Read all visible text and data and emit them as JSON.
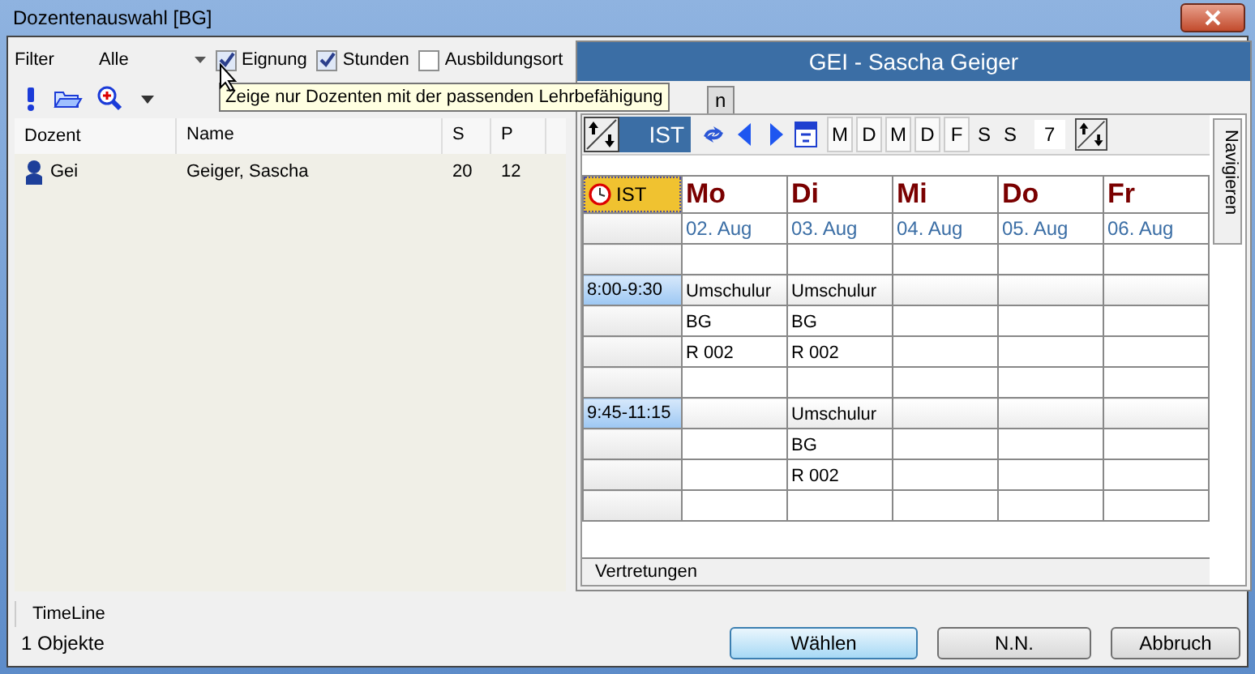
{
  "window": {
    "title": "Dozentenauswahl [BG]"
  },
  "filter": {
    "label": "Filter",
    "value": "Alle",
    "checkboxes": [
      {
        "label": "Eignung",
        "checked": true
      },
      {
        "label": "Stunden",
        "checked": true
      },
      {
        "label": "Ausbildungsort",
        "checked": false
      }
    ]
  },
  "tooltip": "Zeige nur Dozenten mit der passenden Lehrbefähigung",
  "table": {
    "columns": [
      "Dozent",
      "Name",
      "S",
      "P"
    ],
    "rows": [
      {
        "cells": [
          "Gei",
          "Geiger, Sascha",
          "20",
          "12"
        ],
        "selected": false
      }
    ]
  },
  "detail": {
    "title": "GEI - Sascha Geiger",
    "tabs": [
      {
        "label": "n"
      }
    ],
    "mode": "IST",
    "weekdays": [
      {
        "label": "M",
        "on": true
      },
      {
        "label": "D",
        "on": true
      },
      {
        "label": "M",
        "on": true
      },
      {
        "label": "D",
        "on": true
      },
      {
        "label": "F",
        "on": true
      },
      {
        "label": "S",
        "on": false
      },
      {
        "label": "S",
        "on": false
      }
    ],
    "day_count": "7",
    "corner": "IST",
    "days": [
      {
        "name": "Mo",
        "date": "02. Aug"
      },
      {
        "name": "Di",
        "date": "03. Aug"
      },
      {
        "name": "Mi",
        "date": "04. Aug"
      },
      {
        "name": "Do",
        "date": "05. Aug"
      },
      {
        "name": "Fr",
        "date": "06. Aug"
      }
    ],
    "slots": [
      {
        "time": "8:00-9:30",
        "cells": [
          [
            "Umschulur",
            "BG",
            "R 002"
          ],
          [
            "Umschulur",
            "BG",
            "R 002"
          ],
          [],
          [],
          []
        ]
      },
      {
        "time": "9:45-11:15",
        "cells": [
          [],
          [
            "Umschulur",
            "BG",
            "R 002"
          ],
          [],
          [],
          []
        ]
      }
    ],
    "side_tab": "Navigieren",
    "footer_tab": "Vertretungen"
  },
  "bottom": {
    "tab": "TimeLine",
    "status": "1 Objekte",
    "buttons": [
      {
        "label": "Wählen",
        "default": true
      },
      {
        "label": "N.N.",
        "default": false
      },
      {
        "label": "Abbruch",
        "default": false
      }
    ]
  }
}
